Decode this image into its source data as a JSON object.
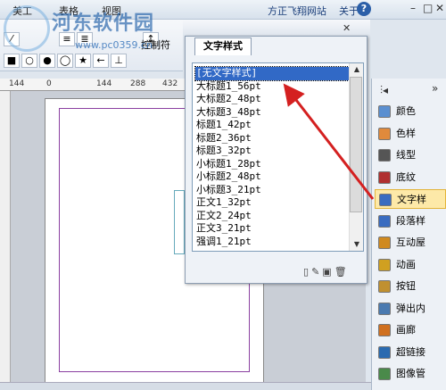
{
  "menu": {
    "items": [
      "美工",
      "表格",
      "视图"
    ]
  },
  "watermark": {
    "text": "河东软件园",
    "url": "www.pc0359.cn"
  },
  "top_links": {
    "site": "方正飞翔网站",
    "about": "关于",
    "help": "?"
  },
  "window_controls": {
    "minimize": "–",
    "restore": "□",
    "close": "✕"
  },
  "toolbar": {
    "control_label": "控制符"
  },
  "ruler": {
    "ticks": [
      "144",
      "0",
      "144",
      "288",
      "432"
    ]
  },
  "style_panel": {
    "tab_label": "文字样式",
    "close": "✕",
    "selected_index": 0,
    "styles": [
      "[无文字样式]",
      "大标题1_56pt",
      "大标题2_48pt",
      "大标题3_48pt",
      "标题1_42pt",
      "标题2_36pt",
      "标题3_32pt",
      "小标题1_28pt",
      "小标题2_48pt",
      "小标题3_21pt",
      "正文1_32pt",
      "正文2_24pt",
      "正文3_21pt",
      "强调1_21pt"
    ]
  },
  "sidebar": {
    "header_left": "⫶◂",
    "header_right": "»",
    "active_index": 4,
    "items": [
      {
        "label": "颜色",
        "icon": "palette-icon",
        "color": "#5a8fd0"
      },
      {
        "label": "色样",
        "icon": "swatch-icon",
        "color": "#e08a3c"
      },
      {
        "label": "线型",
        "icon": "line-style-icon",
        "color": "#555555"
      },
      {
        "label": "底纹",
        "icon": "pattern-icon",
        "color": "#b03030"
      },
      {
        "label": "文字样",
        "icon": "text-style-icon",
        "color": "#3a6cc0"
      },
      {
        "label": "段落样",
        "icon": "paragraph-style-icon",
        "color": "#3a6cc0"
      },
      {
        "label": "互动屋",
        "icon": "interactive-icon",
        "color": "#d08a20"
      },
      {
        "label": "动画",
        "icon": "animation-icon",
        "color": "#d0a020"
      },
      {
        "label": "按钮",
        "icon": "button-icon",
        "color": "#c09030"
      },
      {
        "label": "弹出内",
        "icon": "popup-icon",
        "color": "#4a7ab0"
      },
      {
        "label": "画廊",
        "icon": "gallery-icon",
        "color": "#d07020"
      },
      {
        "label": "超链接",
        "icon": "hyperlink-icon",
        "color": "#2a6ab0"
      },
      {
        "label": "图像管",
        "icon": "image-manager-icon",
        "color": "#4a8a4a"
      }
    ]
  },
  "accent_color": "#3169c6",
  "arrow_color": "#d42020"
}
